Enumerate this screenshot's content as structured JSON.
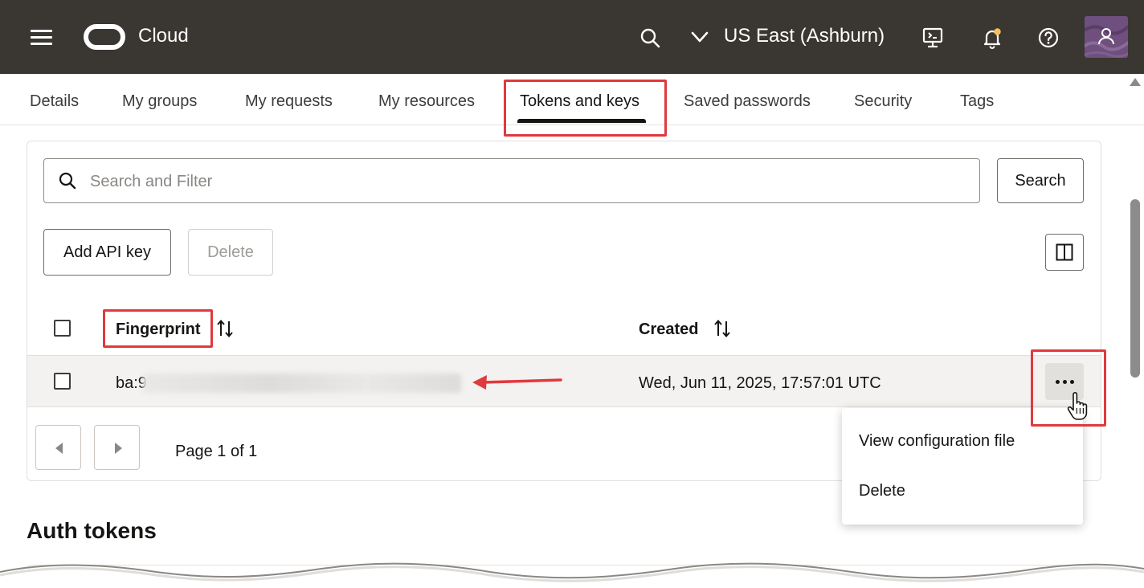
{
  "topbar": {
    "brand": "Cloud",
    "region": "US East (Ashburn)",
    "icons": [
      "menu-icon",
      "oracle-logo",
      "search-icon",
      "chevron-down-icon",
      "cloud-shell-icon",
      "bell-icon",
      "help-icon",
      "avatar"
    ],
    "bg_color": "#3a3631"
  },
  "tabs": [
    {
      "label": "Details"
    },
    {
      "label": "My groups"
    },
    {
      "label": "My requests"
    },
    {
      "label": "My resources"
    },
    {
      "label": "Tokens and keys",
      "active": true
    },
    {
      "label": "Saved passwords"
    },
    {
      "label": "Security"
    },
    {
      "label": "Tags"
    }
  ],
  "search": {
    "placeholder": "Search and Filter",
    "button_label": "Search"
  },
  "actions": {
    "add_label": "Add API key",
    "delete_label": "Delete"
  },
  "table": {
    "columns": [
      "Fingerprint",
      "Created"
    ],
    "rows": [
      {
        "fingerprint_prefix": "ba:9",
        "created": "Wed, Jun 11, 2025, 17:57:01 UTC"
      }
    ]
  },
  "pagination": {
    "text": "Page 1 of 1"
  },
  "row_menu": {
    "items": [
      "View configuration file",
      "Delete"
    ]
  },
  "auth_tokens": {
    "title": "Auth tokens"
  },
  "annotation_color": "#e0393e"
}
